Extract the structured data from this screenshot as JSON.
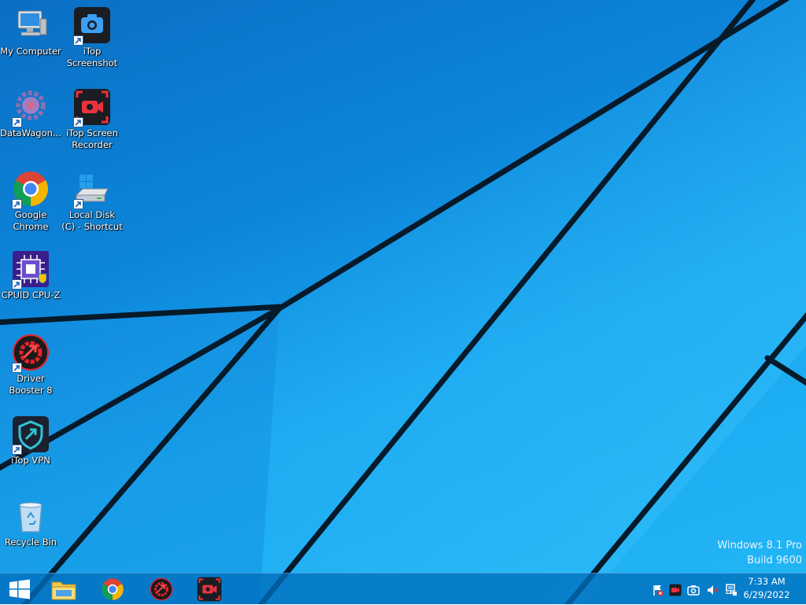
{
  "desktop": {
    "icons": [
      {
        "label": "My Computer",
        "icon": "computer-icon"
      },
      {
        "label": "iTop Screenshot",
        "icon": "itop-screenshot-icon"
      },
      {
        "label": "DataWagon...",
        "icon": "datawagon-gear-icon"
      },
      {
        "label": "iTop Screen Recorder",
        "icon": "itop-screen-recorder-icon"
      },
      {
        "label": "Google Chrome",
        "icon": "chrome-icon"
      },
      {
        "label": "Local Disk (C) - Shortcut",
        "icon": "drive-icon"
      },
      {
        "label": "CPUID CPU-Z",
        "icon": "cpuz-icon"
      },
      {
        "label": "Driver Booster 8",
        "icon": "driver-booster-icon"
      },
      {
        "label": "iTop VPN",
        "icon": "itop-vpn-icon"
      },
      {
        "label": "Recycle Bin",
        "icon": "recycle-bin-icon"
      }
    ],
    "watermark": {
      "line1": "Windows 8.1 Pro",
      "line2": "Build 9600"
    }
  },
  "taskbar": {
    "start": "start-windows-icon",
    "pinned": [
      "file-explorer-icon",
      "chrome-icon",
      "driver-booster-icon",
      "itop-screen-recorder-icon"
    ],
    "tray": [
      "notification-flag-icon",
      "recorder-tray-icon",
      "camera-tray-icon",
      "volume-muted-icon",
      "network-icon"
    ],
    "clock": {
      "time": "7:33 AM",
      "date": "6/29/2022"
    }
  },
  "colors": {
    "accent": "#1a9ee8",
    "taskbar": "#0a6dbd"
  }
}
